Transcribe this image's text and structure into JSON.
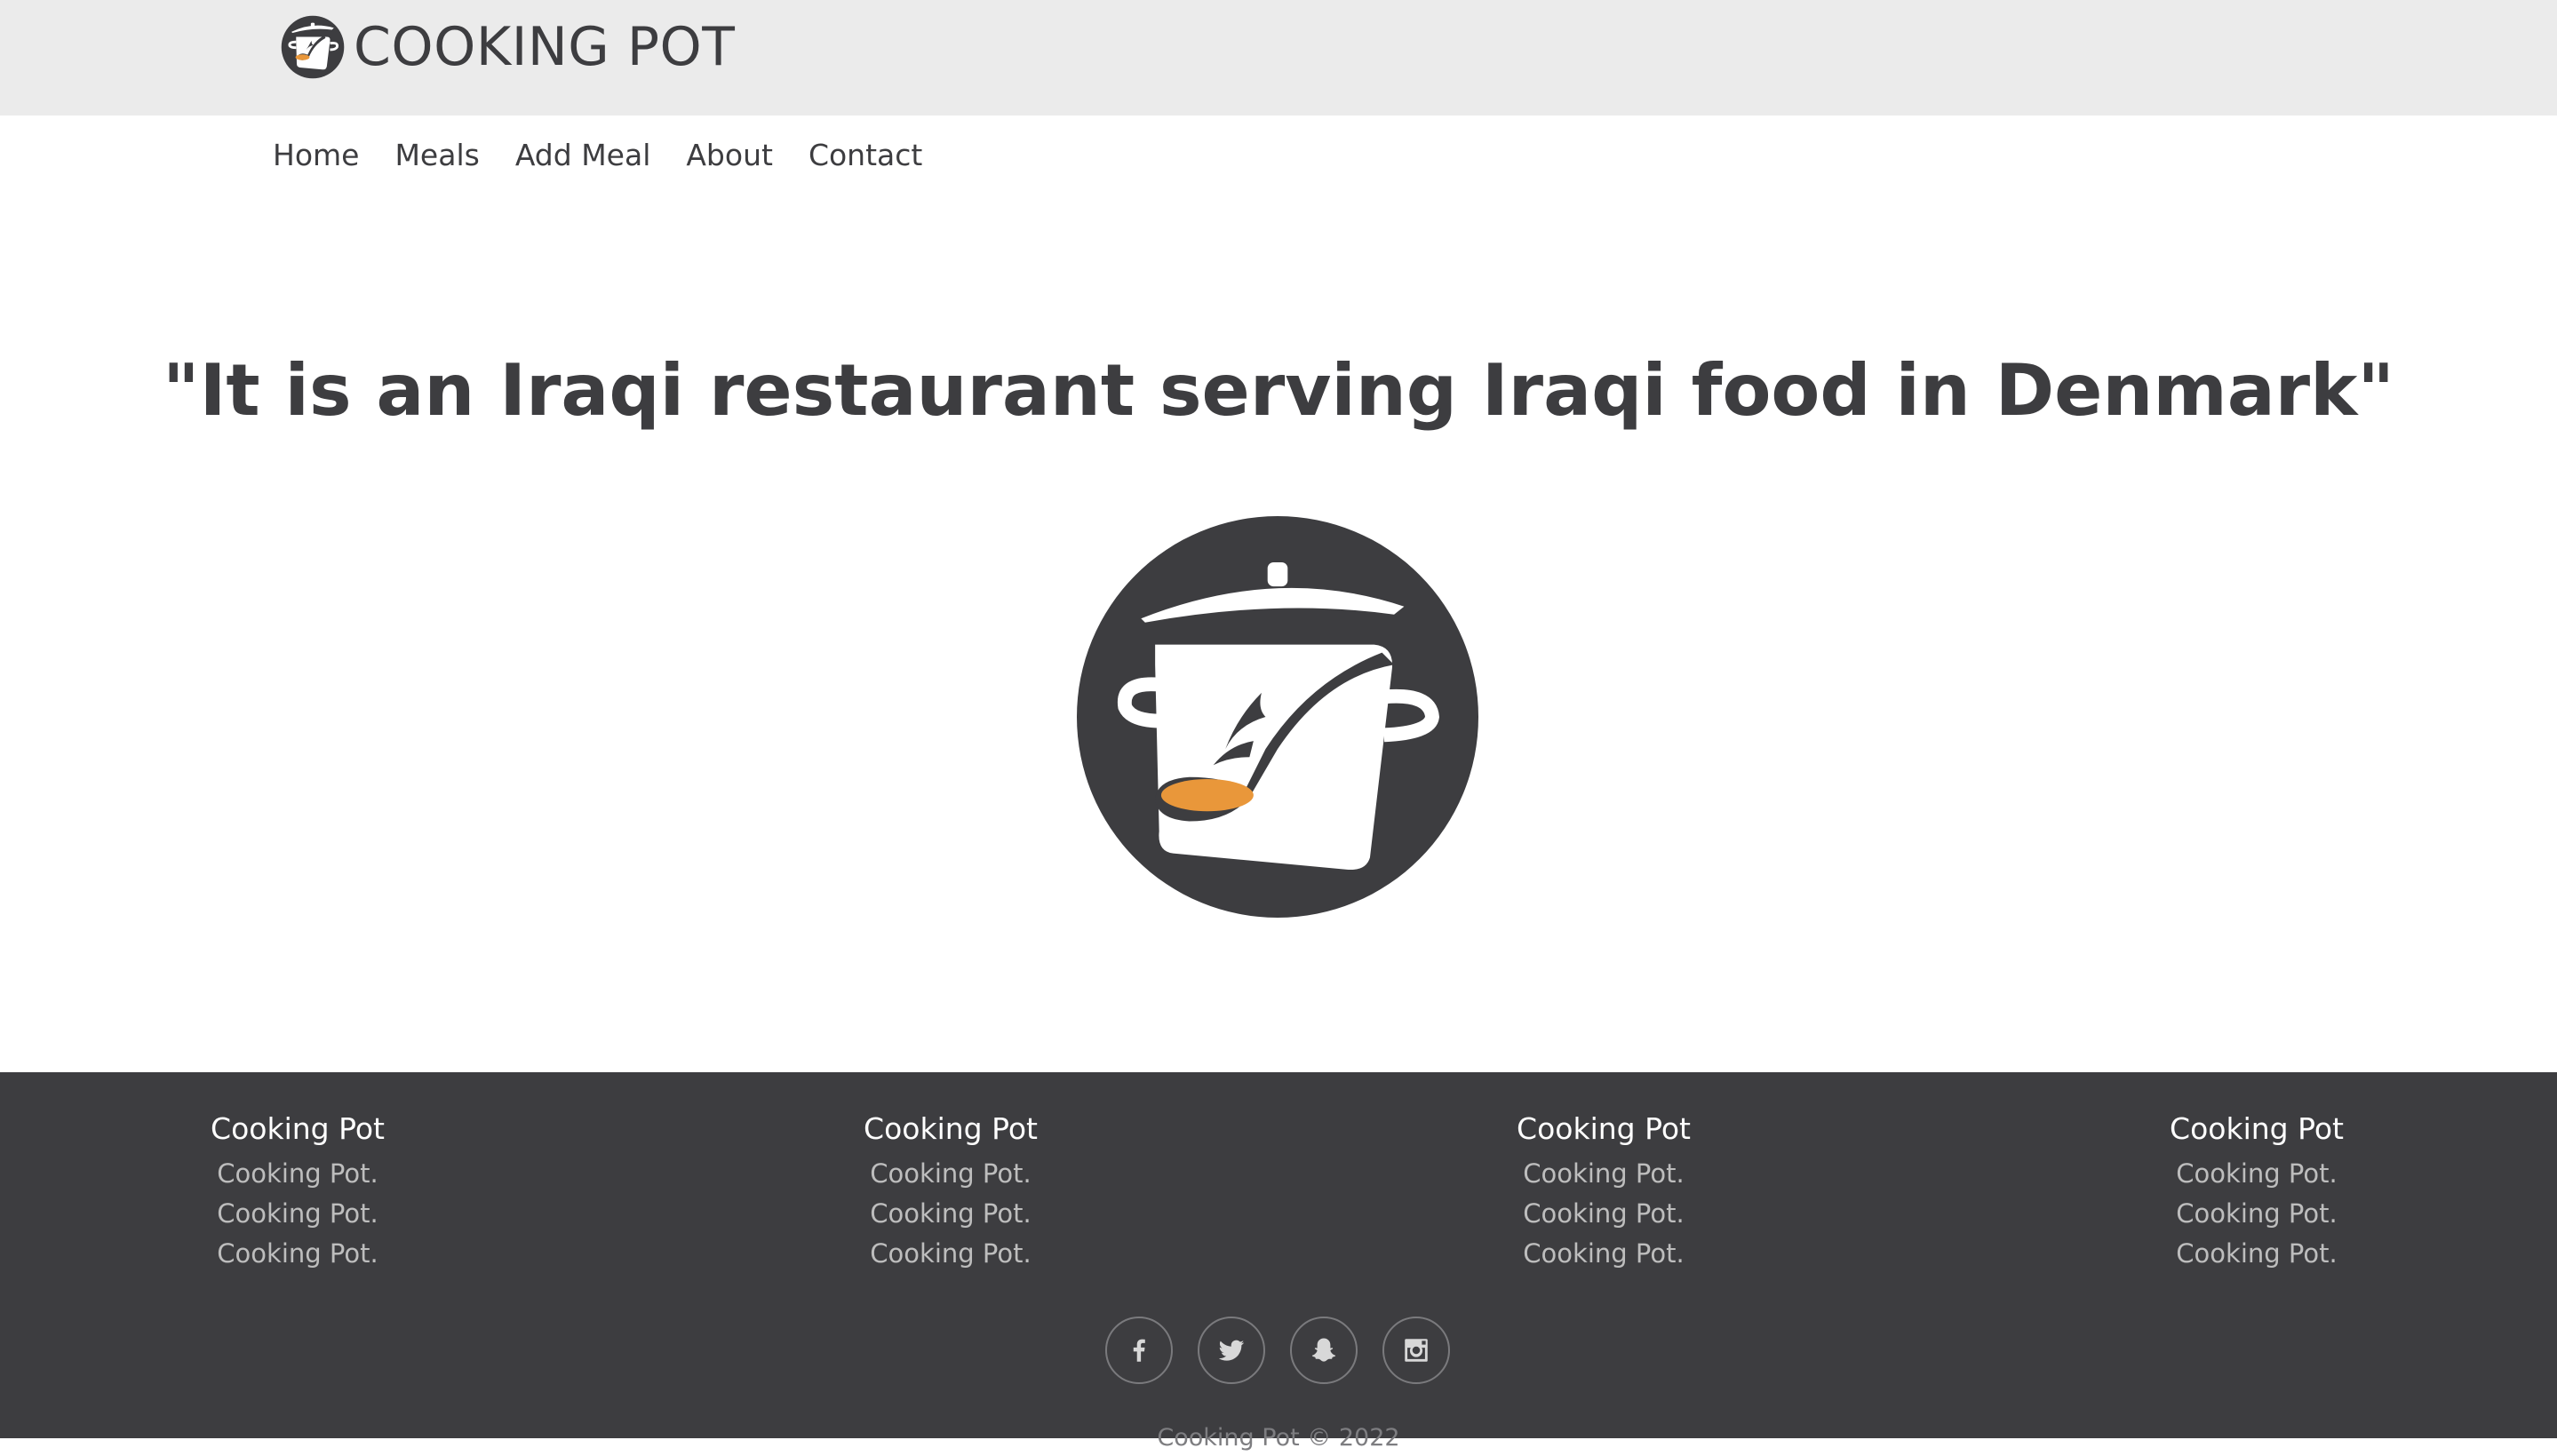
{
  "header": {
    "brand": "COOKING POT"
  },
  "nav": {
    "items": [
      "Home",
      "Meals",
      "Add Meal",
      "About",
      "Contact"
    ]
  },
  "hero": {
    "quote": "\"It is an Iraqi restaurant serving Iraqi food in Denmark\""
  },
  "footer": {
    "columns": [
      {
        "title": "Cooking Pot",
        "links": [
          "Cooking Pot.",
          "Cooking Pot.",
          "Cooking Pot."
        ]
      },
      {
        "title": "Cooking Pot",
        "links": [
          "Cooking Pot.",
          "Cooking Pot.",
          "Cooking Pot."
        ]
      },
      {
        "title": "Cooking Pot",
        "links": [
          "Cooking Pot.",
          "Cooking Pot.",
          "Cooking Pot."
        ]
      },
      {
        "title": "Cooking Pot",
        "links": [
          "Cooking Pot.",
          "Cooking Pot.",
          "Cooking Pot."
        ]
      }
    ],
    "social_icons": [
      "facebook-icon",
      "twitter-icon",
      "snapchat-icon",
      "instagram-icon"
    ],
    "copyright": "Cooking Pot © 2022"
  },
  "colors": {
    "header_bg": "#ebebeb",
    "text_dark": "#3d3d40",
    "footer_bg": "#3d3d40",
    "footer_link": "#bdbdbd",
    "accent_orange": "#e9973a"
  }
}
